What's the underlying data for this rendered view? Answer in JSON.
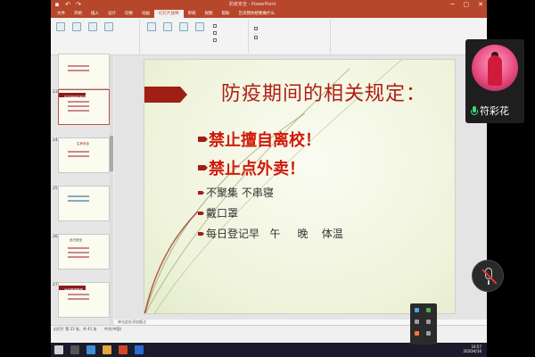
{
  "app": {
    "window_title": "防疫安全 - PowerPoint",
    "tabs": [
      "文件",
      "开始",
      "插入",
      "设计",
      "切换",
      "动画",
      "幻灯片放映",
      "审阅",
      "视图",
      "帮助",
      "告诉我你想要做什么"
    ],
    "active_tab_index": 6
  },
  "slide": {
    "title": "防疫期间的相关规定：",
    "bullets_big": [
      "禁止擅自离校！",
      "禁止点外卖！"
    ],
    "bullets_small": [
      "不聚集  不串寝",
      "戴口罩",
      "每日登记早   午     晚    体温"
    ]
  },
  "thumbnails": [
    {
      "num": "23",
      "title": "防疫期间的相关规定"
    },
    {
      "num": "24",
      "title": "生命安全"
    },
    {
      "num": "25",
      "title": ""
    },
    {
      "num": "26",
      "title": "出行安全"
    },
    {
      "num": "27",
      "title": "地产教育教育"
    }
  ],
  "notes_placeholder": "单击此处添加备注",
  "status": {
    "slide_info": "幻灯片 第 23 张，共 41 张",
    "language": "中文(中国)"
  },
  "participant": {
    "name": "符彩花"
  },
  "taskbar": {
    "time": "16:57",
    "date": "2020/4/16"
  },
  "colors": {
    "ppt_red": "#b7472a",
    "slide_accent": "#a01e14",
    "bullet_red": "#d11a0a"
  }
}
